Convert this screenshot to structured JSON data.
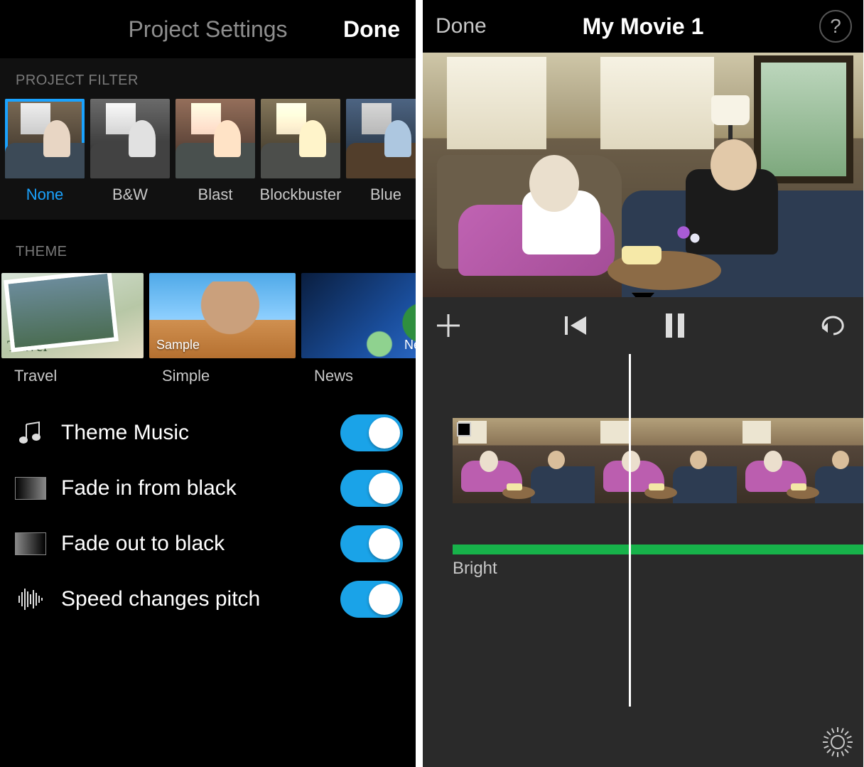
{
  "left": {
    "nav": {
      "title": "Project Settings",
      "done": "Done"
    },
    "sections": {
      "filter": "PROJECT FILTER",
      "theme": "THEME"
    },
    "filters": [
      {
        "label": "None",
        "selected": true
      },
      {
        "label": "B&W"
      },
      {
        "label": "Blast"
      },
      {
        "label": "Blockbuster"
      },
      {
        "label": "Blue"
      }
    ],
    "themes": [
      {
        "label": "Travel",
        "badge": "Travel"
      },
      {
        "label": "Simple",
        "badge": "Sample"
      },
      {
        "label": "News",
        "badge": "News"
      }
    ],
    "options": [
      {
        "icon": "music",
        "label": "Theme Music",
        "on": true
      },
      {
        "icon": "fadein",
        "label": "Fade in from black",
        "on": true
      },
      {
        "icon": "fadeout",
        "label": "Fade out to black",
        "on": true
      },
      {
        "icon": "wave",
        "label": "Speed changes pitch",
        "on": true
      }
    ]
  },
  "right": {
    "nav": {
      "done": "Done",
      "title": "My Movie 1",
      "help": "?"
    },
    "audio_label": "Bright"
  }
}
